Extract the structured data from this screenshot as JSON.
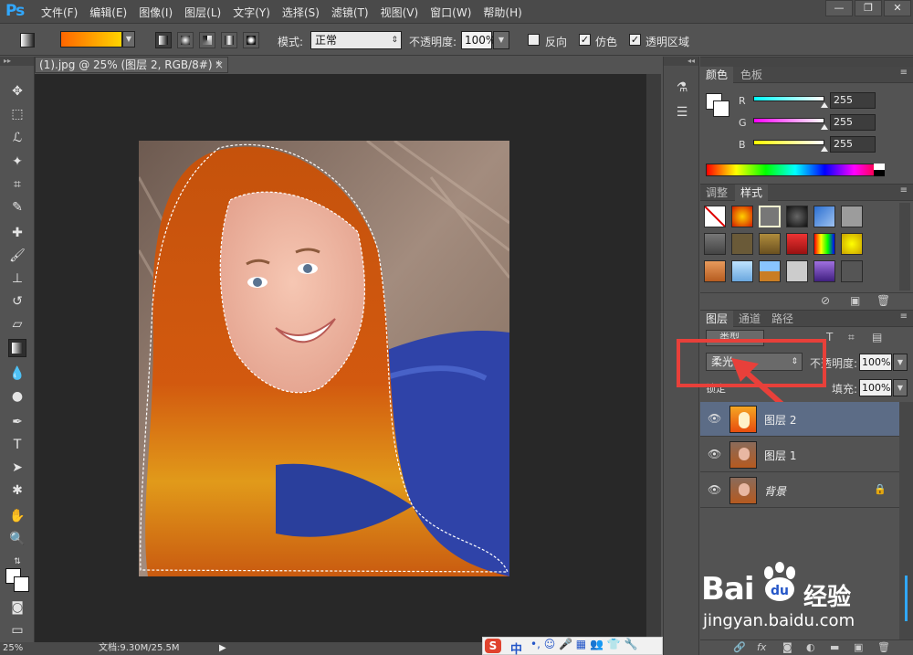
{
  "app": {
    "logo": "Ps",
    "menu": [
      "文件(F)",
      "编辑(E)",
      "图像(I)",
      "图层(L)",
      "文字(Y)",
      "选择(S)",
      "滤镜(T)",
      "视图(V)",
      "窗口(W)",
      "帮助(H)"
    ],
    "window_controls": [
      "—",
      "❐",
      "✕"
    ]
  },
  "options": {
    "mode_label": "模式:",
    "mode_value": "正常",
    "opacity_label": "不透明度:",
    "opacity_value": "100%",
    "reverse_label": "反向",
    "dither_label": "仿色",
    "transparency_label": "透明区域",
    "reverse_checked": false,
    "dither_checked": true,
    "transparency_checked": true
  },
  "document": {
    "tab_title": "(1).jpg @ 25% (图层 2, RGB/8#) *",
    "close": "×",
    "zoom": "25%",
    "doc_info": "文档:9.30M/25.5M"
  },
  "color_panel": {
    "tabs": [
      "颜色",
      "色板"
    ],
    "r_label": "R",
    "g_label": "G",
    "b_label": "B",
    "r": "255",
    "g": "255",
    "b": "255"
  },
  "styles_panel": {
    "tabs": [
      "调整",
      "样式"
    ]
  },
  "layers_panel": {
    "tabs": [
      "图层",
      "通道",
      "路径"
    ],
    "kind_label": "类型",
    "blend_mode": "柔光",
    "opacity_label": "不透明度:",
    "opacity_value": "100%",
    "lock_label": "锁定",
    "fill_label": "填充:",
    "fill_value": "100%",
    "layers": [
      {
        "name": "图层 2",
        "selected": true
      },
      {
        "name": "图层 1",
        "selected": false
      },
      {
        "name": "背景",
        "selected": false
      }
    ]
  },
  "watermark": {
    "brand": "Bai",
    "brand2": "du",
    "brand_cn": "经验",
    "url": "jingyan.baidu.com"
  },
  "taskbar": {
    "ime": "中"
  },
  "colors": {
    "accent": "#31a8ff",
    "selected_layer": "#5c6c86",
    "highlight_box": "#e8403a"
  }
}
